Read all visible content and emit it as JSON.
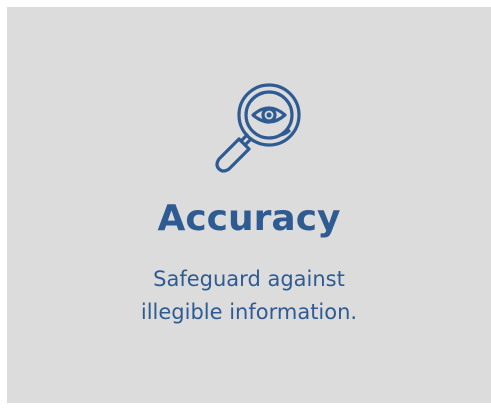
{
  "card": {
    "icon": "magnifier-eye-icon",
    "title": "Accuracy",
    "description_lines": [
      "Safeguard against",
      "illegible information."
    ]
  },
  "colors": {
    "background": "#dcdcdc",
    "accent": "#2f5b93"
  }
}
